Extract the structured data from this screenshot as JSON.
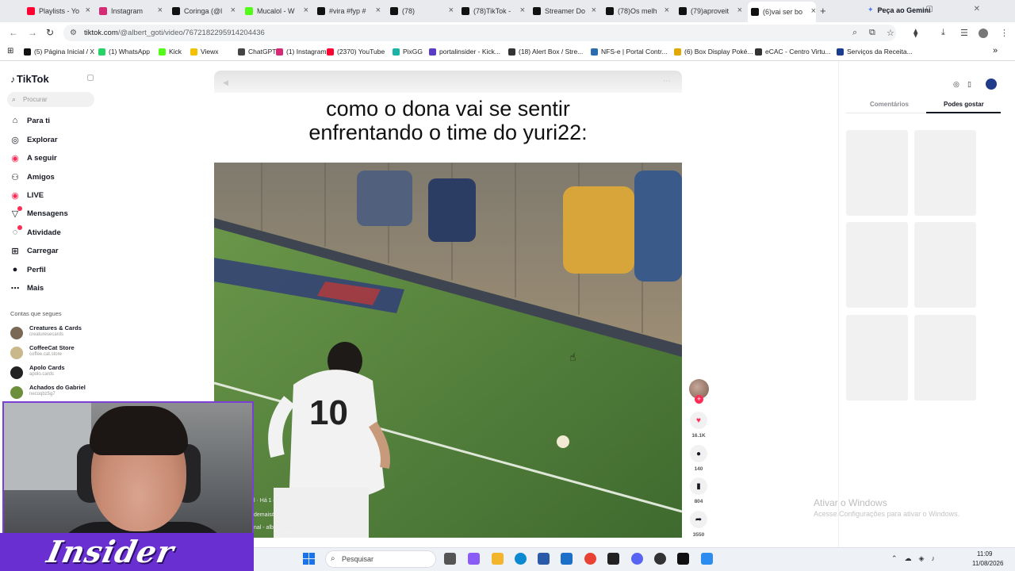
{
  "browser": {
    "tabs": [
      {
        "title": "Playlists - Yo",
        "color": "#ff0033"
      },
      {
        "title": "Instagram",
        "color": "#d62976"
      },
      {
        "title": "Coringa (@l",
        "color": "#111111"
      },
      {
        "title": "Mucalol - W",
        "color": "#53fc18"
      },
      {
        "title": "#vira #fyp #",
        "color": "#111111"
      },
      {
        "title": "(78)",
        "color": "#111111"
      },
      {
        "title": "(78)TikTok -",
        "color": "#111111"
      },
      {
        "title": "Streamer Do",
        "color": "#111111"
      },
      {
        "title": "(78)Os melh",
        "color": "#111111"
      },
      {
        "title": "(79)aproveit",
        "color": "#111111"
      },
      {
        "title": "(6)vai ser bo",
        "color": "#111111",
        "active": true
      }
    ],
    "new_tab": "+",
    "gemini_label": "Peça ao Gemini",
    "window_controls": "— ▢ ✕",
    "url_host": "tiktok.com",
    "url_path": "/@albert_goti/video/7672182295914204436",
    "bookmarks": [
      {
        "label": "(5) Página Inicial / X",
        "color": "#111111"
      },
      {
        "label": "(1) WhatsApp",
        "color": "#25d366"
      },
      {
        "label": "Kick",
        "color": "#53fc18"
      },
      {
        "label": "Viewx",
        "color": "#f2c200"
      },
      {
        "label": "ChatGPT",
        "color": "#444444"
      },
      {
        "label": "(1) Instagram",
        "color": "#d62976"
      },
      {
        "label": "(2370) YouTube",
        "color": "#ff0033"
      },
      {
        "label": "PixGG",
        "color": "#1bb3a6"
      },
      {
        "label": "portalinsider - Kick...",
        "color": "#5b3cc4"
      },
      {
        "label": "(18) Alert Box / Stre...",
        "color": "#333333"
      },
      {
        "label": "NFS-e | Portal Contr...",
        "color": "#2b6cb0"
      },
      {
        "label": "(6) Box Display Poké...",
        "color": "#e0a800"
      },
      {
        "label": "eCAC - Centro Virtu...",
        "color": "#333333"
      },
      {
        "label": "Serviços da Receita...",
        "color": "#1a3d8f"
      }
    ],
    "bookmarks_more": "»"
  },
  "sidebar": {
    "logo": "TikTok",
    "search_placeholder": "Procurar",
    "nav": [
      {
        "label": "Para ti",
        "icon": "home-icon",
        "glyph": "⌂"
      },
      {
        "label": "Explorar",
        "icon": "compass-icon",
        "glyph": "◎"
      },
      {
        "label": "A seguir",
        "icon": "following-icon",
        "glyph": "◉"
      },
      {
        "label": "Amigos",
        "icon": "friends-icon",
        "glyph": "⚇"
      },
      {
        "label": "LIVE",
        "icon": "live-icon",
        "glyph": "◉"
      },
      {
        "label": "Mensagens",
        "icon": "messages-icon",
        "glyph": "▽",
        "badge": true
      },
      {
        "label": "Atividade",
        "icon": "activity-icon",
        "glyph": "◌",
        "badge": true
      },
      {
        "label": "Carregar",
        "icon": "upload-icon",
        "glyph": "⊞"
      },
      {
        "label": "Perfil",
        "icon": "profile-icon",
        "glyph": "●"
      },
      {
        "label": "Mais",
        "icon": "more-icon",
        "glyph": "⋯"
      }
    ],
    "following_heading": "Contas que segues",
    "accounts": [
      {
        "name": "Creatures & Cards",
        "handle": "creaturesecards",
        "color": "#7a6a55"
      },
      {
        "name": "CoffeeCat Store",
        "handle": "coffee.cat.store",
        "color": "#c9b98a"
      },
      {
        "name": "Apolo Cards",
        "handle": "apolo.cards",
        "color": "#222222"
      },
      {
        "name": "Achados do Gabriel",
        "handle": "necoqbz5g7",
        "color": "#6b8f3a"
      }
    ]
  },
  "video": {
    "caption_line1": "como o dona vai se sentir",
    "caption_line2": "enfrentando o time do yuri22:",
    "meta_time": "l · Há 1 d",
    "meta_tags": "demais#dona #yuri22 #fyp",
    "meta_sound": "nal - albert_goti",
    "player_number": "10"
  },
  "actions": {
    "like_count": "16.1K",
    "comment_count": "140",
    "save_count": "804",
    "share_count": "3550",
    "like_color": "#fe2c55"
  },
  "right_panel": {
    "tab_comments": "Comentários",
    "tab_suggested": "Podes gostar"
  },
  "overlay": {
    "brand": "Insider"
  },
  "windows": {
    "activate_title": "Ativar o Windows",
    "activate_sub": "Acesse Configurações para ativar o Windows.",
    "search_label": "Pesquisar",
    "clock_time": "11:09",
    "clock_date": "11/08/2026"
  }
}
